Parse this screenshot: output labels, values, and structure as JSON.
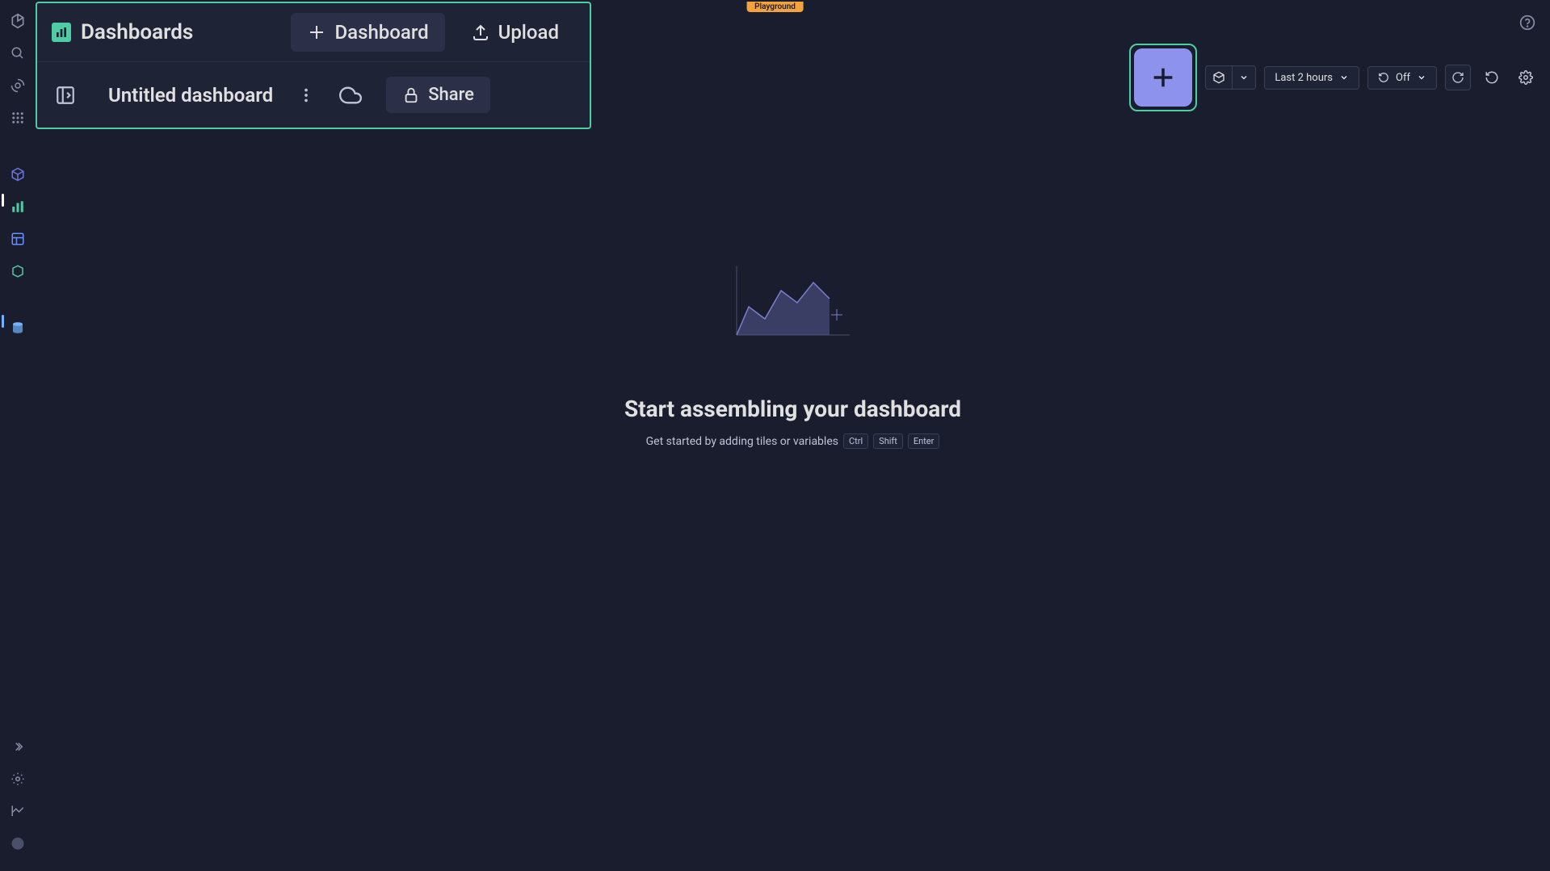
{
  "badge": "Playground",
  "header": {
    "title": "Dashboards",
    "new_dashboard": "Dashboard",
    "upload": "Upload",
    "row2": {
      "name": "Untitled dashboard",
      "share": "Share"
    }
  },
  "toolbar": {
    "time_range": "Last 2 hours",
    "auto_refresh": "Off"
  },
  "empty": {
    "title": "Start assembling your dashboard",
    "subtitle": "Get started by adding tiles or variables",
    "keys": [
      "Ctrl",
      "Shift",
      "Enter"
    ]
  }
}
